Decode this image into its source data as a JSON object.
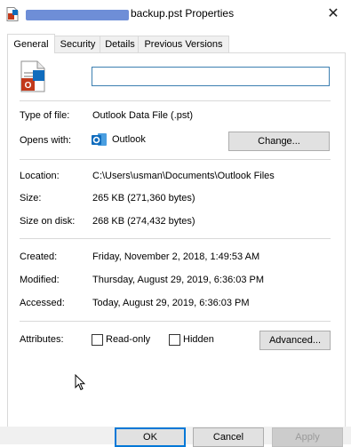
{
  "window": {
    "title": "backup.pst Properties",
    "close_glyph": "✕"
  },
  "tabs": [
    {
      "label": "General",
      "active": true
    },
    {
      "label": "Security",
      "active": false
    },
    {
      "label": "Details",
      "active": false
    },
    {
      "label": "Previous Versions",
      "active": false
    }
  ],
  "general": {
    "name_value": "",
    "type_label": "Type of file:",
    "type_value": "Outlook Data File (.pst)",
    "opens_label": "Opens with:",
    "opens_app": "Outlook",
    "change_button": "Change...",
    "location_label": "Location:",
    "location_value": "C:\\Users\\usman\\Documents\\Outlook Files",
    "size_label": "Size:",
    "size_value": "265 KB (271,360 bytes)",
    "size_on_disk_label": "Size on disk:",
    "size_on_disk_value": "268 KB (274,432 bytes)",
    "created_label": "Created:",
    "created_value": "Friday, November 2, 2018, 1:49:53 AM",
    "modified_label": "Modified:",
    "modified_value": "Thursday, August 29, 2019, 6:36:03 PM",
    "accessed_label": "Accessed:",
    "accessed_value": "Today, August 29, 2019, 6:36:03 PM",
    "attributes_label": "Attributes:",
    "readonly_label": "Read-only",
    "readonly_checked": false,
    "hidden_label": "Hidden",
    "hidden_checked": false,
    "advanced_button": "Advanced..."
  },
  "footer": {
    "ok": "OK",
    "cancel": "Cancel",
    "apply": "Apply"
  },
  "colors": {
    "outlook_blue": "#0f6cbd",
    "accent": "#0078d7",
    "redaction": "#6e8ed7"
  },
  "icons": {
    "title": "pst-file-icon",
    "file": "pst-file-icon",
    "app": "outlook-icon",
    "close": "close-icon",
    "cursor": "mouse-pointer-icon"
  }
}
